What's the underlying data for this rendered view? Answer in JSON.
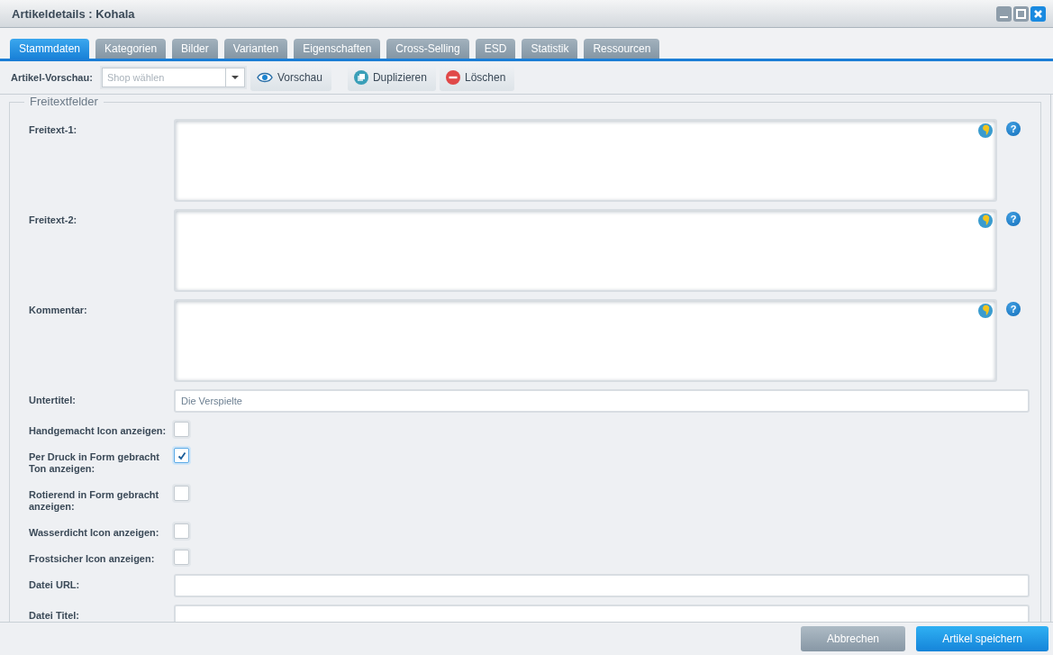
{
  "window": {
    "title": "Artikeldetails : Kohala"
  },
  "tabs": [
    {
      "label": "Stammdaten",
      "selected": true
    },
    {
      "label": "Kategorien",
      "selected": false
    },
    {
      "label": "Bilder",
      "selected": false
    },
    {
      "label": "Varianten",
      "selected": false
    },
    {
      "label": "Eigenschaften",
      "selected": false
    },
    {
      "label": "Cross-Selling",
      "selected": false
    },
    {
      "label": "ESD",
      "selected": false
    },
    {
      "label": "Statistik",
      "selected": false
    },
    {
      "label": "Ressourcen",
      "selected": false
    }
  ],
  "toolbar": {
    "preview_label": "Artikel-Vorschau:",
    "shop_select": {
      "placeholder": "Shop wählen"
    },
    "buttons": [
      {
        "kind": "preview",
        "label": "Vorschau"
      },
      {
        "kind": "duplicate",
        "label": "Duplizieren"
      },
      {
        "kind": "delete",
        "label": "Löschen"
      }
    ]
  },
  "fieldset": {
    "legend": "Freitextfelder",
    "fields": [
      {
        "kind": "textarea",
        "label": "Freitext-1:",
        "translatable": true,
        "help": "?"
      },
      {
        "kind": "textarea",
        "label": "Freitext-2:",
        "translatable": true,
        "help": "?"
      },
      {
        "kind": "textarea",
        "label": "Kommentar:",
        "translatable": true,
        "help": "?"
      },
      {
        "kind": "text",
        "label": "Untertitel:",
        "value": "Die Verspielte"
      },
      {
        "kind": "checkbox",
        "label": "Handgemacht Icon anzeigen:",
        "checked": false
      },
      {
        "kind": "checkbox",
        "label": "Per Druck in Form gebracht Ton anzeigen:",
        "checked": true
      },
      {
        "kind": "checkbox",
        "label": "Rotierend in Form gebracht anzeigen:",
        "checked": false
      },
      {
        "kind": "checkbox",
        "label": "Wasserdicht Icon anzeigen:",
        "checked": false
      },
      {
        "kind": "checkbox",
        "label": "Frostsicher Icon anzeigen:",
        "checked": false
      },
      {
        "kind": "text",
        "label": "Datei URL:"
      },
      {
        "kind": "text",
        "label": "Datei Titel:"
      }
    ]
  },
  "footer": {
    "buttons": [
      {
        "kind": "secondary",
        "label": "Abbrechen"
      },
      {
        "kind": "primary",
        "label": "Artikel speichern"
      }
    ]
  }
}
